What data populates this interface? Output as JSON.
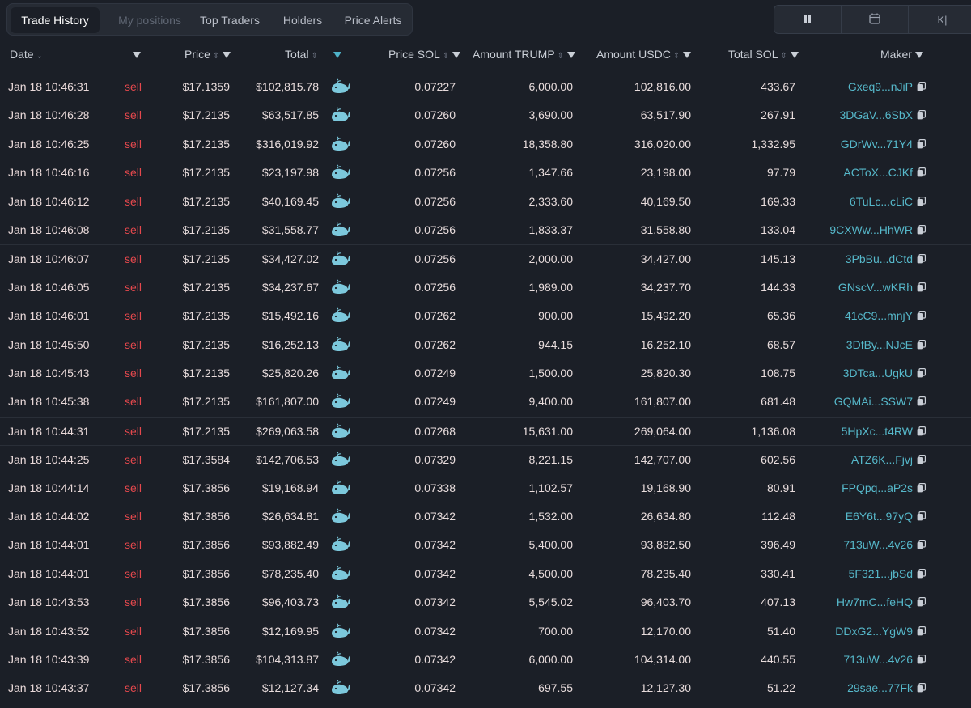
{
  "tabs": [
    {
      "label": "Trade History",
      "state": "active"
    },
    {
      "label": "My positions",
      "state": "muted"
    },
    {
      "label": "Top Traders",
      "state": "normal"
    },
    {
      "label": "Holders",
      "state": "normal"
    },
    {
      "label": "Price Alerts",
      "state": "normal"
    }
  ],
  "controls": {
    "pause_icon": "pause-icon",
    "calendar_icon": "calendar-icon",
    "third_label": "K|"
  },
  "columns": {
    "date": "Date",
    "price": "Price",
    "total": "Total",
    "price_sol": "Price SOL",
    "amount_trump": "Amount TRUMP",
    "amount_usdc": "Amount USDC",
    "total_sol": "Total SOL",
    "maker": "Maker"
  },
  "colors": {
    "sell": "#e5484d",
    "maker": "#56b8ca",
    "whale": "#7cc8dc",
    "background": "#1b1f27"
  },
  "rows": [
    {
      "date": "Jan 18 10:46:31",
      "type": "sell",
      "price": "$17.1359",
      "total": "$102,815.78",
      "price_sol": "0.07227",
      "amount_trump": "6,000.00",
      "amount_usdc": "102,816.00",
      "total_sol": "433.67",
      "maker": "Gxeq9...nJiP"
    },
    {
      "date": "Jan 18 10:46:28",
      "type": "sell",
      "price": "$17.2135",
      "total": "$63,517.85",
      "price_sol": "0.07260",
      "amount_trump": "3,690.00",
      "amount_usdc": "63,517.90",
      "total_sol": "267.91",
      "maker": "3DGaV...6SbX"
    },
    {
      "date": "Jan 18 10:46:25",
      "type": "sell",
      "price": "$17.2135",
      "total": "$316,019.92",
      "price_sol": "0.07260",
      "amount_trump": "18,358.80",
      "amount_usdc": "316,020.00",
      "total_sol": "1,332.95",
      "maker": "GDrWv...71Y4"
    },
    {
      "date": "Jan 18 10:46:16",
      "type": "sell",
      "price": "$17.2135",
      "total": "$23,197.98",
      "price_sol": "0.07256",
      "amount_trump": "1,347.66",
      "amount_usdc": "23,198.00",
      "total_sol": "97.79",
      "maker": "ACToX...CJKf"
    },
    {
      "date": "Jan 18 10:46:12",
      "type": "sell",
      "price": "$17.2135",
      "total": "$40,169.45",
      "price_sol": "0.07256",
      "amount_trump": "2,333.60",
      "amount_usdc": "40,169.50",
      "total_sol": "169.33",
      "maker": "6TuLc...cLiC"
    },
    {
      "date": "Jan 18 10:46:08",
      "type": "sell",
      "price": "$17.2135",
      "total": "$31,558.77",
      "price_sol": "0.07256",
      "amount_trump": "1,833.37",
      "amount_usdc": "31,558.80",
      "total_sol": "133.04",
      "maker": "9CXWw...HhWR"
    },
    {
      "date": "Jan 18 10:46:07",
      "type": "sell",
      "price": "$17.2135",
      "total": "$34,427.02",
      "price_sol": "0.07256",
      "amount_trump": "2,000.00",
      "amount_usdc": "34,427.00",
      "total_sol": "145.13",
      "maker": "3PbBu...dCtd"
    },
    {
      "date": "Jan 18 10:46:05",
      "type": "sell",
      "price": "$17.2135",
      "total": "$34,237.67",
      "price_sol": "0.07256",
      "amount_trump": "1,989.00",
      "amount_usdc": "34,237.70",
      "total_sol": "144.33",
      "maker": "GNscV...wKRh"
    },
    {
      "date": "Jan 18 10:46:01",
      "type": "sell",
      "price": "$17.2135",
      "total": "$15,492.16",
      "price_sol": "0.07262",
      "amount_trump": "900.00",
      "amount_usdc": "15,492.20",
      "total_sol": "65.36",
      "maker": "41cC9...mnjY"
    },
    {
      "date": "Jan 18 10:45:50",
      "type": "sell",
      "price": "$17.2135",
      "total": "$16,252.13",
      "price_sol": "0.07262",
      "amount_trump": "944.15",
      "amount_usdc": "16,252.10",
      "total_sol": "68.57",
      "maker": "3DfBy...NJcE"
    },
    {
      "date": "Jan 18 10:45:43",
      "type": "sell",
      "price": "$17.2135",
      "total": "$25,820.26",
      "price_sol": "0.07249",
      "amount_trump": "1,500.00",
      "amount_usdc": "25,820.30",
      "total_sol": "108.75",
      "maker": "3DTca...UgkU"
    },
    {
      "date": "Jan 18 10:45:38",
      "type": "sell",
      "price": "$17.2135",
      "total": "$161,807.00",
      "price_sol": "0.07249",
      "amount_trump": "9,400.00",
      "amount_usdc": "161,807.00",
      "total_sol": "681.48",
      "maker": "GQMAi...SSW7"
    },
    {
      "date": "Jan 18 10:44:31",
      "type": "sell",
      "price": "$17.2135",
      "total": "$269,063.58",
      "price_sol": "0.07268",
      "amount_trump": "15,631.00",
      "amount_usdc": "269,064.00",
      "total_sol": "1,136.08",
      "maker": "5HpXc...t4RW"
    },
    {
      "date": "Jan 18 10:44:25",
      "type": "sell",
      "price": "$17.3584",
      "total": "$142,706.53",
      "price_sol": "0.07329",
      "amount_trump": "8,221.15",
      "amount_usdc": "142,707.00",
      "total_sol": "602.56",
      "maker": "ATZ6K...Fjvj"
    },
    {
      "date": "Jan 18 10:44:14",
      "type": "sell",
      "price": "$17.3856",
      "total": "$19,168.94",
      "price_sol": "0.07338",
      "amount_trump": "1,102.57",
      "amount_usdc": "19,168.90",
      "total_sol": "80.91",
      "maker": "FPQpq...aP2s"
    },
    {
      "date": "Jan 18 10:44:02",
      "type": "sell",
      "price": "$17.3856",
      "total": "$26,634.81",
      "price_sol": "0.07342",
      "amount_trump": "1,532.00",
      "amount_usdc": "26,634.80",
      "total_sol": "112.48",
      "maker": "E6Y6t...97yQ"
    },
    {
      "date": "Jan 18 10:44:01",
      "type": "sell",
      "price": "$17.3856",
      "total": "$93,882.49",
      "price_sol": "0.07342",
      "amount_trump": "5,400.00",
      "amount_usdc": "93,882.50",
      "total_sol": "396.49",
      "maker": "713uW...4v26"
    },
    {
      "date": "Jan 18 10:44:01",
      "type": "sell",
      "price": "$17.3856",
      "total": "$78,235.40",
      "price_sol": "0.07342",
      "amount_trump": "4,500.00",
      "amount_usdc": "78,235.40",
      "total_sol": "330.41",
      "maker": "5F321...jbSd"
    },
    {
      "date": "Jan 18 10:43:53",
      "type": "sell",
      "price": "$17.3856",
      "total": "$96,403.73",
      "price_sol": "0.07342",
      "amount_trump": "5,545.02",
      "amount_usdc": "96,403.70",
      "total_sol": "407.13",
      "maker": "Hw7mC...feHQ"
    },
    {
      "date": "Jan 18 10:43:52",
      "type": "sell",
      "price": "$17.3856",
      "total": "$12,169.95",
      "price_sol": "0.07342",
      "amount_trump": "700.00",
      "amount_usdc": "12,170.00",
      "total_sol": "51.40",
      "maker": "DDxG2...YgW9"
    },
    {
      "date": "Jan 18 10:43:39",
      "type": "sell",
      "price": "$17.3856",
      "total": "$104,313.87",
      "price_sol": "0.07342",
      "amount_trump": "6,000.00",
      "amount_usdc": "104,314.00",
      "total_sol": "440.55",
      "maker": "713uW...4v26"
    },
    {
      "date": "Jan 18 10:43:37",
      "type": "sell",
      "price": "$17.3856",
      "total": "$12,127.34",
      "price_sol": "0.07342",
      "amount_trump": "697.55",
      "amount_usdc": "12,127.30",
      "total_sol": "51.22",
      "maker": "29sae...77Fk"
    }
  ]
}
